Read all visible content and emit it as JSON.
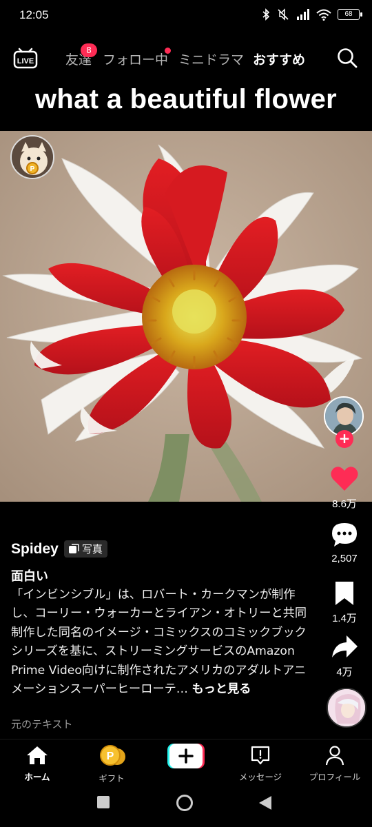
{
  "status": {
    "time": "12:05",
    "battery": "68"
  },
  "top_nav": {
    "live_label": "LIVE",
    "tabs": [
      {
        "label": "友達"
      },
      {
        "label": "フォロー中"
      },
      {
        "label": "ミニドラマ"
      },
      {
        "label": "おすすめ"
      }
    ],
    "friends_badge": "8"
  },
  "post": {
    "title": "what a beautiful flower",
    "author": "Spidey",
    "tag": "写真",
    "caption_title": "面白い",
    "caption_body": "「インビンシブル」は、ロバート・カークマンが制作し、コーリー・ウォーカーとライアン・オトリーと共同制作した同名のイメージ・コミックスのコミックブックシリーズを基に、ストリーミングサービスのAmazon Prime Video向けに制作されたアメリカのアダルトアニメーションスーパーヒーローテ…",
    "more": "もっと見る",
    "original_text": "元のテキスト"
  },
  "rail": {
    "likes": "8.6万",
    "comments": "2,507",
    "saves": "1.4万",
    "shares": "4万"
  },
  "bottom_nav": {
    "items": [
      {
        "label": "ホーム"
      },
      {
        "label": "ギフト"
      },
      {
        "label": ""
      },
      {
        "label": "メッセージ"
      },
      {
        "label": "プロフィール"
      }
    ]
  },
  "colors": {
    "accent": "#fe2c55",
    "background": "#000000"
  }
}
